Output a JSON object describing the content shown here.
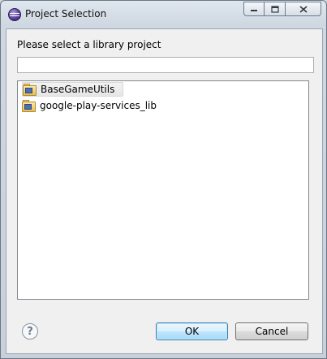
{
  "window": {
    "title": "Project Selection",
    "app_icon": "eclipse-icon",
    "controls": {
      "minimize": "minimize-icon",
      "maximize": "maximize-icon",
      "close": "close-icon"
    }
  },
  "dialog": {
    "prompt": "Please select a library project",
    "filter": {
      "value": "",
      "placeholder": ""
    },
    "projects": [
      {
        "label": "BaseGameUtils",
        "icon": "project-folder-icon",
        "selected": true
      },
      {
        "label": "google-play-services_lib",
        "icon": "project-folder-icon",
        "selected": false
      }
    ]
  },
  "buttons": {
    "help_icon": "help-icon",
    "ok_label": "OK",
    "cancel_label": "Cancel"
  }
}
